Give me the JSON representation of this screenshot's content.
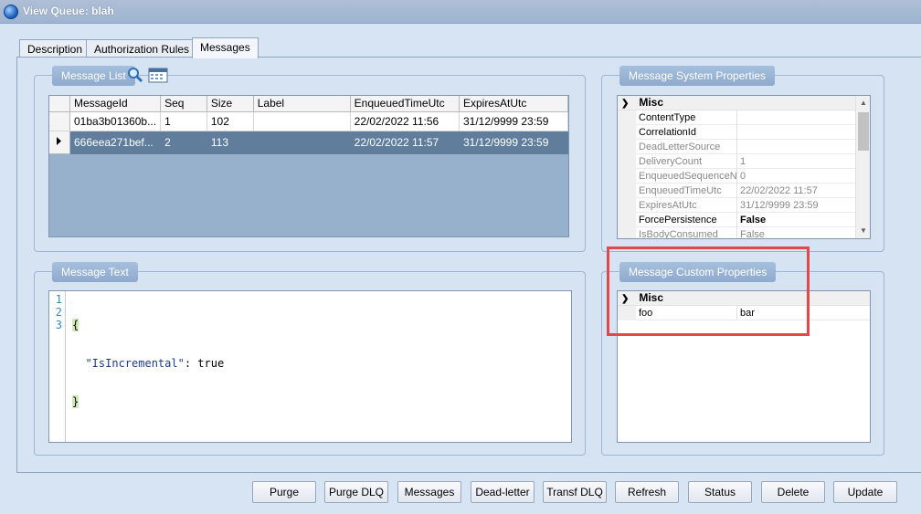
{
  "window": {
    "title": "View Queue: blah"
  },
  "tabs": [
    {
      "label": "Description"
    },
    {
      "label": "Authorization Rules"
    },
    {
      "label": "Messages"
    }
  ],
  "message_list": {
    "header": "Message List",
    "columns": [
      "MessageId",
      "Seq",
      "Size",
      "Label",
      "EnqueuedTimeUtc",
      "ExpiresAtUtc"
    ],
    "rows": [
      {
        "id": "01ba3b01360b...",
        "seq": "1",
        "size": "102",
        "label": "",
        "enqueued": "22/02/2022 11:56",
        "expires": "31/12/9999 23:59"
      },
      {
        "id": "666eea271bef...",
        "seq": "2",
        "size": "113",
        "label": "",
        "enqueued": "22/02/2022 11:57",
        "expires": "31/12/9999 23:59"
      }
    ]
  },
  "message_text": {
    "header": "Message Text",
    "line_numbers": [
      "1",
      "2",
      "3"
    ],
    "lines": {
      "open": "{",
      "key": "\"IsIncremental\"",
      "rest": ": true",
      "close": "}"
    }
  },
  "system_properties": {
    "header": "Message System Properties",
    "category": "Misc",
    "rows": [
      {
        "name": "ContentType",
        "value": ""
      },
      {
        "name": "CorrelationId",
        "value": ""
      },
      {
        "name": "DeadLetterSource",
        "value": ""
      },
      {
        "name": "DeliveryCount",
        "value": "1"
      },
      {
        "name": "EnqueuedSequenceN",
        "value": "0"
      },
      {
        "name": "EnqueuedTimeUtc",
        "value": "22/02/2022 11:57"
      },
      {
        "name": "ExpiresAtUtc",
        "value": "31/12/9999 23:59"
      },
      {
        "name": "ForcePersistence",
        "value": "False"
      },
      {
        "name": "IsBodyConsumed",
        "value": "False"
      }
    ]
  },
  "custom_properties": {
    "header": "Message Custom Properties",
    "category": "Misc",
    "rows": [
      {
        "name": "foo",
        "value": "bar"
      }
    ]
  },
  "buttons": {
    "purge": "Purge",
    "purge_dlq": "Purge DLQ",
    "messages": "Messages",
    "dead_letter": "Dead-letter",
    "transf_dlq": "Transf DLQ",
    "refresh": "Refresh",
    "status": "Status",
    "delete": "Delete",
    "update": "Update"
  },
  "colors": {
    "highlight": "#e0484a",
    "selected_row": "#607d9c",
    "group_header": "#9bb5d8"
  },
  "icons": {
    "search": "magnifier-icon",
    "calendar": "calendar-icon"
  }
}
